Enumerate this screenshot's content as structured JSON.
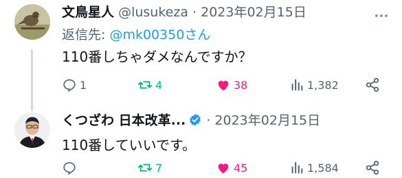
{
  "tweets": [
    {
      "name": "文鳥星人",
      "handle": "@lusukeza",
      "date": "2023年02月15日",
      "reply_to_label": "返信先:",
      "reply_to_mention": "@mk00350さん",
      "text": "110番しちゃダメなんですか？",
      "replies": "1",
      "retweets": "4",
      "likes": "38",
      "views": "1,382"
    },
    {
      "name": "くつざわ 日本改革...",
      "date": "2023年02月15日",
      "text": "110番していいです。",
      "replies": "",
      "retweets": "7",
      "likes": "45",
      "views": "1,584"
    }
  ],
  "separator": "·",
  "colors": {
    "retweet": "#00ba7c",
    "like": "#f91880",
    "mention": "#1d9bf0",
    "muted": "#536471",
    "verified": "#1d9bf0"
  },
  "icons": [
    "reply-icon",
    "retweet-icon",
    "heart-icon",
    "views-icon",
    "share-icon",
    "more-icon",
    "verified-badge-icon"
  ]
}
